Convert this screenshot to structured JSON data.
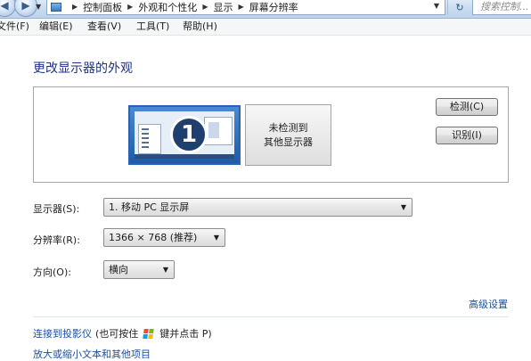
{
  "breadcrumb": {
    "items": [
      "控制面板",
      "外观和个性化",
      "显示",
      "屏幕分辨率"
    ]
  },
  "search": {
    "placeholder": "搜索控制..."
  },
  "menu": {
    "items": [
      "文件(F)",
      "编辑(E)",
      "查看(V)",
      "工具(T)",
      "帮助(H)"
    ]
  },
  "page": {
    "title": "更改显示器的外观"
  },
  "preview": {
    "monitor1_number": "1",
    "monitor2_label": "未检测到\n其他显示器"
  },
  "buttons": {
    "detect": "检测(C)",
    "identify": "识别(I)"
  },
  "settings": {
    "display_label": "显示器(S):",
    "display_value": "1. 移动 PC 显示屏",
    "resolution_label": "分辨率(R):",
    "resolution_value": "1366 × 768 (推荐)",
    "orientation_label": "方向(O):",
    "orientation_value": "横向"
  },
  "links": {
    "advanced": "高级设置",
    "projector": "连接到投影仪",
    "projector_hint_pre": "(也可按住",
    "projector_hint_post": "键并点击 P)",
    "text_size": "放大或缩小文本和其他项目"
  },
  "icons": {
    "back": "back-arrow-icon",
    "forward": "forward-arrow-icon",
    "address": "control-panel-icon",
    "refresh": "refresh-icon",
    "windows": "windows-logo-icon"
  },
  "colors": {
    "title": "#1e3287",
    "link": "#1e50a2",
    "monitor_selected": "#2a62b3"
  }
}
